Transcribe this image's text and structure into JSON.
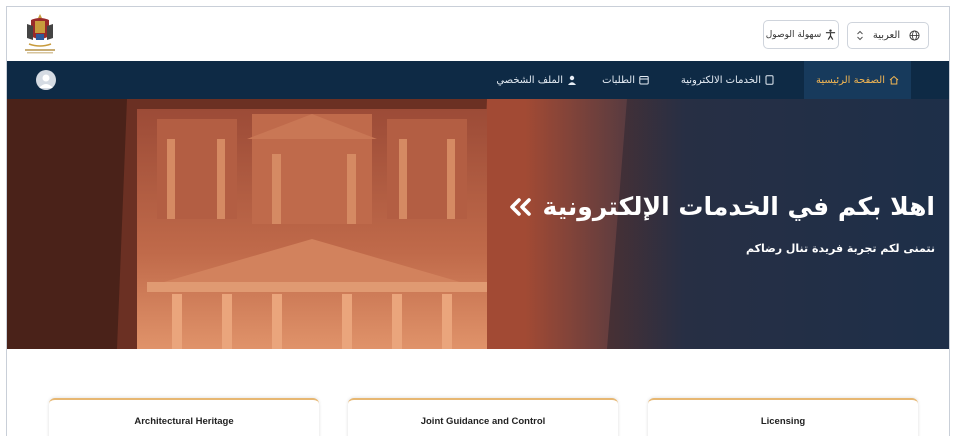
{
  "header": {
    "logo_icon": "jordan-coat-of-arms-icon",
    "language_select": {
      "value": "العربية",
      "icon": "globe-icon"
    },
    "accessibility_button": {
      "label": "سهولة الوصول",
      "icon": "accessibility-icon"
    }
  },
  "nav": {
    "items": [
      {
        "label": "الصفحة الرئيسية",
        "icon": "home-icon",
        "active": true
      },
      {
        "label": "الخدمات الالكترونية",
        "icon": "document-icon",
        "active": false
      },
      {
        "label": "الطلبات",
        "icon": "calendar-icon",
        "active": false
      },
      {
        "label": "الملف الشخصي",
        "icon": "user-icon",
        "active": false
      }
    ],
    "avatar_icon": "user-avatar-icon"
  },
  "hero": {
    "title": "اهلا بكم في الخدمات الإلكترونية",
    "title_icon": "double-chevron-left-icon",
    "subtitle": "نتمنى لكم تجربة فريدة تنال رضاكم"
  },
  "cards": [
    {
      "title": "Architectural Heritage"
    },
    {
      "title": "Joint Guidance and Control"
    },
    {
      "title": "Licensing"
    }
  ],
  "colors": {
    "nav_bg": "#0e2a45",
    "nav_active_text": "#f2b653",
    "card_accent": "#e7b772"
  }
}
